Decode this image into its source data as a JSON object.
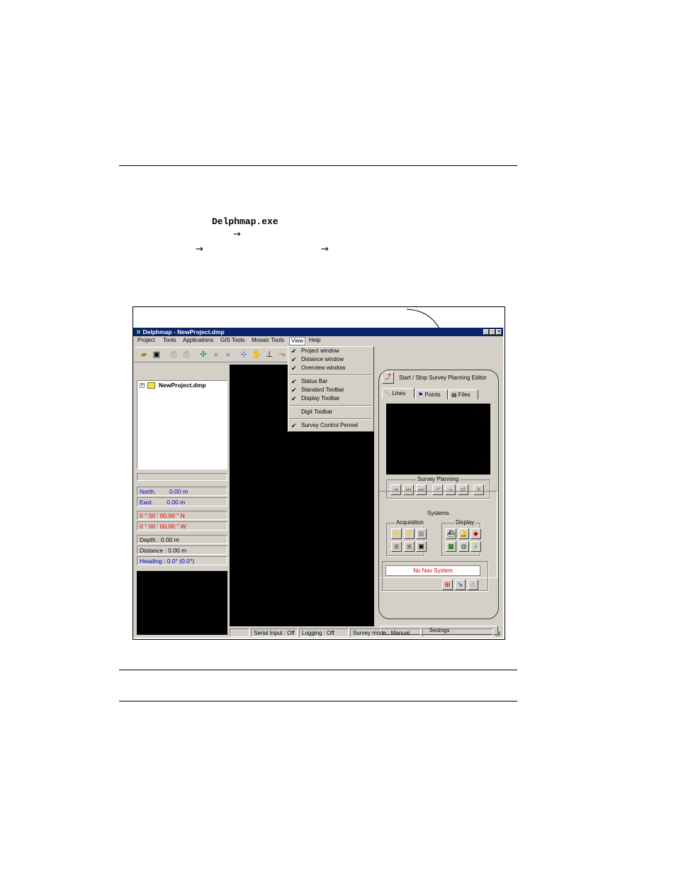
{
  "doc": {
    "exe_name": "Delphmap.exe",
    "arrow_glyph": "→"
  },
  "app": {
    "title": "Delphmap - NewProject.dmp",
    "menu": [
      "Project",
      "Tools",
      "Applications",
      "GIS Tools",
      "Mosaic Tools",
      "View",
      "Help"
    ],
    "view_menu": [
      {
        "label": "Project window",
        "checked": true
      },
      {
        "label": "Distance window",
        "checked": true
      },
      {
        "label": "Overview window",
        "checked": true
      },
      {
        "label": "Status Bar",
        "checked": true
      },
      {
        "label": "Standard Toolbar",
        "checked": true
      },
      {
        "label": "Display Toolbar",
        "checked": true
      },
      {
        "label": "Digit Toolbar",
        "checked": false
      },
      {
        "label": "Survey Control Pennel",
        "checked": true
      }
    ],
    "tree_root": "NewProject.dmp",
    "coords": {
      "north": "North.        0.00 m",
      "east": "East.        0.00 m",
      "lat": "0 ° 00 ' 00.00 \" N",
      "lon": "0 ° 00 ' 00.00 \" W",
      "depth": "Depth : 0.00 m",
      "distance": "Distance : 0.00 m",
      "heading": "Heading : 0.0° (0.0°)"
    },
    "survey": {
      "editor_label": "Start / Stop Survey Planning Editor",
      "tabs": [
        "Lines",
        "Points",
        "Files"
      ],
      "planning_label": "Survey Planning",
      "systems_label": "Systems",
      "acquisition_label": "Acquisition",
      "display_label": "Display",
      "nav_status": "No Nav System",
      "settings_label": "Settings"
    },
    "status": {
      "serial": "Serial Input : Off",
      "logging": "Logging : Off",
      "mode": "Survey mode : Manual"
    },
    "colors": {
      "titlebar": "#0a246a",
      "face": "#d4d0c8",
      "coord_blue": "#0000c8",
      "coord_red": "#e00000"
    }
  }
}
